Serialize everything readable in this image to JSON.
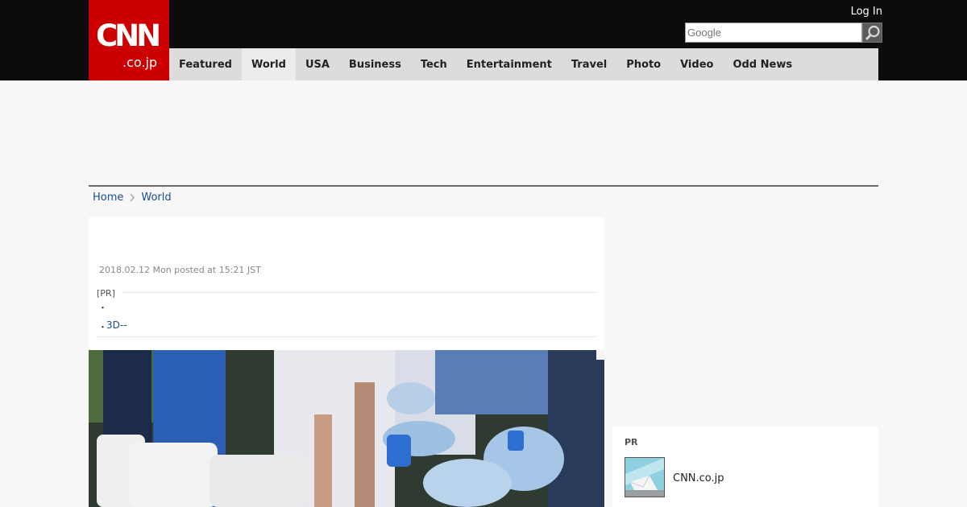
{
  "header": {
    "logo_main": "CNN",
    "logo_sub": ".co.jp",
    "login_label": "Log In",
    "search_placeholder": "Google"
  },
  "nav": {
    "items": [
      {
        "label": "Featured"
      },
      {
        "label": "World"
      },
      {
        "label": "USA"
      },
      {
        "label": "Business"
      },
      {
        "label": "Tech"
      },
      {
        "label": "Entertainment"
      },
      {
        "label": "Travel"
      },
      {
        "label": "Photo"
      },
      {
        "label": "Video"
      },
      {
        "label": "Odd News"
      }
    ]
  },
  "breadcrumb": {
    "home": "Home",
    "current": "World"
  },
  "article": {
    "dateline": "2018.02.12 Mon posted at 15:21 JST",
    "pr_label": "[PR]",
    "pr_link": "3D--",
    "bullet": "・"
  },
  "sidebar": {
    "pr_title": "PR",
    "pr_item_label": "CNN.co.jp"
  },
  "colors": {
    "brand_red": "#cc0000",
    "link_blue": "#1a4e86",
    "header_bg": "#0c0c0c",
    "nav_bg": "#dcdcdc"
  }
}
